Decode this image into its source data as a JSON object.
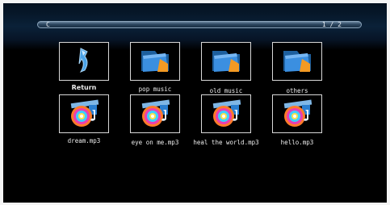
{
  "path_bar": {
    "path": "C",
    "page": "1 / 2"
  },
  "items": [
    {
      "label": "Return",
      "icon": "return-arrow-icon"
    },
    {
      "label": "pop music",
      "icon": "folder-icon"
    },
    {
      "label": "old music",
      "icon": "folder-icon"
    },
    {
      "label": "others",
      "icon": "folder-icon"
    },
    {
      "label": "dream.mp3",
      "icon": "music-disc-icon"
    },
    {
      "label": "eye on me.mp3",
      "icon": "music-disc-icon"
    },
    {
      "label": "heal the world.mp3",
      "icon": "music-disc-icon"
    },
    {
      "label": "hello.mp3",
      "icon": "music-disc-icon"
    }
  ],
  "colors": {
    "background": "#000000",
    "tile_border": "#d8d8d8",
    "folder_blue": "#2a7fd0",
    "folder_orange": "#f39a23",
    "arrow_blue": "#4aa3e8"
  }
}
